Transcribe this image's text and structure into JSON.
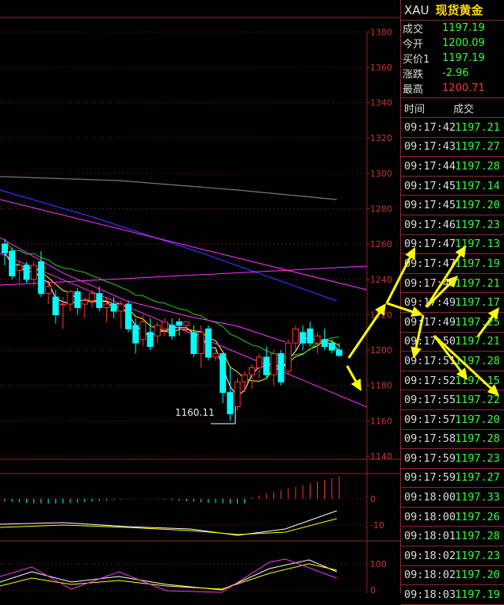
{
  "symbol": "XAU",
  "instrument_name": "现货黄金",
  "colors": {
    "up": "#ff3333",
    "down": "#00ffff",
    "ma_yellow": "#ffff00",
    "ma_green": "#22cc22",
    "ma_blue": "#3333ff",
    "ma_gray": "#777777",
    "channel": "#ff33ff",
    "grid": "#8a2a2a",
    "price_green": "#33ff33",
    "arrow": "#ffff00"
  },
  "quote": [
    {
      "label": "成交",
      "value": "1197.19",
      "color": "#33ff33"
    },
    {
      "label": "今开",
      "value": "1200.09",
      "color": "#33ff33"
    },
    {
      "label": "买价1",
      "value": "1197.19",
      "color": "#33ff33"
    },
    {
      "label": "涨跌",
      "value": "-2.96",
      "color": "#33ff33"
    },
    {
      "label": "最高",
      "value": "1200.71",
      "color": "#ff3333"
    }
  ],
  "ticks_header": {
    "time": "时间",
    "price": "成交"
  },
  "ticks": [
    {
      "t": "09:17:42",
      "p": "1197.21"
    },
    {
      "t": "09:17:43",
      "p": "1197.27"
    },
    {
      "t": "09:17:44",
      "p": "1197.28"
    },
    {
      "t": "09:17:45",
      "p": "1197.14"
    },
    {
      "t": "09:17:45",
      "p": "1197.20"
    },
    {
      "t": "09:17:46",
      "p": "1197.23"
    },
    {
      "t": "09:17:47",
      "p": "1197.13"
    },
    {
      "t": "09:17:47",
      "p": "1197.19"
    },
    {
      "t": "09:17:48",
      "p": "1197.21"
    },
    {
      "t": "09:17:49",
      "p": "1197.17"
    },
    {
      "t": "09:17:49",
      "p": "1197.25"
    },
    {
      "t": "09:17:50",
      "p": "1197.21"
    },
    {
      "t": "09:17:51",
      "p": "1197.28"
    },
    {
      "t": "09:17:52",
      "p": "1197.15"
    },
    {
      "t": "09:17:55",
      "p": "1197.22"
    },
    {
      "t": "09:17:57",
      "p": "1197.20"
    },
    {
      "t": "09:17:58",
      "p": "1197.28"
    },
    {
      "t": "09:17:59",
      "p": "1197.23"
    },
    {
      "t": "09:17:59",
      "p": "1197.27"
    },
    {
      "t": "09:18:00",
      "p": "1197.33"
    },
    {
      "t": "09:18:00",
      "p": "1197.26"
    },
    {
      "t": "09:18:01",
      "p": "1197.28"
    },
    {
      "t": "09:18:02",
      "p": "1197.23"
    },
    {
      "t": "09:18:02",
      "p": "1197.20"
    },
    {
      "t": "09:18:03",
      "p": "1197.19"
    }
  ],
  "chart_data": {
    "type": "candlestick",
    "y_ticks": [
      "1380",
      "1360",
      "1340",
      "1320",
      "1300",
      "1280",
      "1260",
      "1240",
      "1220",
      "1200",
      "1180",
      "1160",
      "1140"
    ],
    "ylim": [
      1140,
      1390
    ],
    "low_label": "1160.11",
    "candles": [
      [
        1260,
        1262,
        1248,
        1255
      ],
      [
        1256,
        1258,
        1240,
        1242
      ],
      [
        1245,
        1250,
        1238,
        1248
      ],
      [
        1248,
        1250,
        1238,
        1240
      ],
      [
        1240,
        1250,
        1236,
        1248
      ],
      [
        1250,
        1256,
        1230,
        1232
      ],
      [
        1232,
        1238,
        1226,
        1236
      ],
      [
        1230,
        1234,
        1215,
        1220
      ],
      [
        1226,
        1230,
        1212,
        1226
      ],
      [
        1226,
        1234,
        1222,
        1233
      ],
      [
        1233,
        1235,
        1220,
        1224
      ],
      [
        1226,
        1230,
        1218,
        1228
      ],
      [
        1228,
        1234,
        1224,
        1232
      ],
      [
        1232,
        1236,
        1222,
        1224
      ],
      [
        1224,
        1230,
        1216,
        1226
      ],
      [
        1226,
        1230,
        1218,
        1222
      ],
      [
        1222,
        1228,
        1212,
        1226
      ],
      [
        1226,
        1228,
        1210,
        1212
      ],
      [
        1214,
        1218,
        1198,
        1204
      ],
      [
        1206,
        1220,
        1202,
        1216
      ],
      [
        1210,
        1218,
        1200,
        1202
      ],
      [
        1208,
        1216,
        1204,
        1214
      ],
      [
        1212,
        1218,
        1208,
        1216
      ],
      [
        1214,
        1218,
        1206,
        1208
      ],
      [
        1216,
        1218,
        1208,
        1214
      ],
      [
        1214,
        1216,
        1210,
        1216
      ],
      [
        1210,
        1214,
        1196,
        1198
      ],
      [
        1198,
        1214,
        1190,
        1210
      ],
      [
        1212,
        1214,
        1194,
        1196
      ],
      [
        1196,
        1200,
        1194,
        1198
      ],
      [
        1198,
        1198,
        1170,
        1176
      ],
      [
        1176,
        1190,
        1160,
        1164
      ],
      [
        1168,
        1184,
        1166,
        1182
      ],
      [
        1182,
        1188,
        1176,
        1186
      ],
      [
        1186,
        1192,
        1178,
        1190
      ],
      [
        1190,
        1198,
        1184,
        1196
      ],
      [
        1196,
        1202,
        1184,
        1186
      ],
      [
        1186,
        1200,
        1180,
        1198
      ],
      [
        1198,
        1200,
        1180,
        1182
      ],
      [
        1188,
        1206,
        1186,
        1204
      ],
      [
        1204,
        1214,
        1200,
        1212
      ],
      [
        1210,
        1214,
        1200,
        1204
      ],
      [
        1212,
        1216,
        1202,
        1204
      ],
      [
        1204,
        1210,
        1198,
        1208
      ],
      [
        1206,
        1212,
        1200,
        1202
      ],
      [
        1204,
        1206,
        1198,
        1200
      ],
      [
        1200,
        1204,
        1196,
        1197
      ]
    ],
    "macd_labels": [
      "0",
      "-10"
    ],
    "kdj_labels": [
      "100",
      "0"
    ]
  }
}
